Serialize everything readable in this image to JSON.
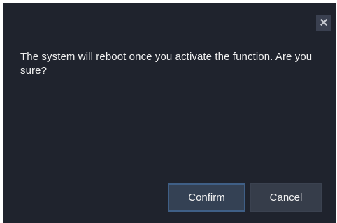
{
  "dialog": {
    "message": "The system will reboot once you activate the function. Are you sure?",
    "close_icon": "close-icon",
    "confirm_label": "Confirm",
    "cancel_label": "Cancel"
  },
  "colors": {
    "dialog_background": "#1f232d",
    "text": "#f0f0f0",
    "confirm_border": "#3f5f86",
    "button_background": "#363d4a"
  }
}
